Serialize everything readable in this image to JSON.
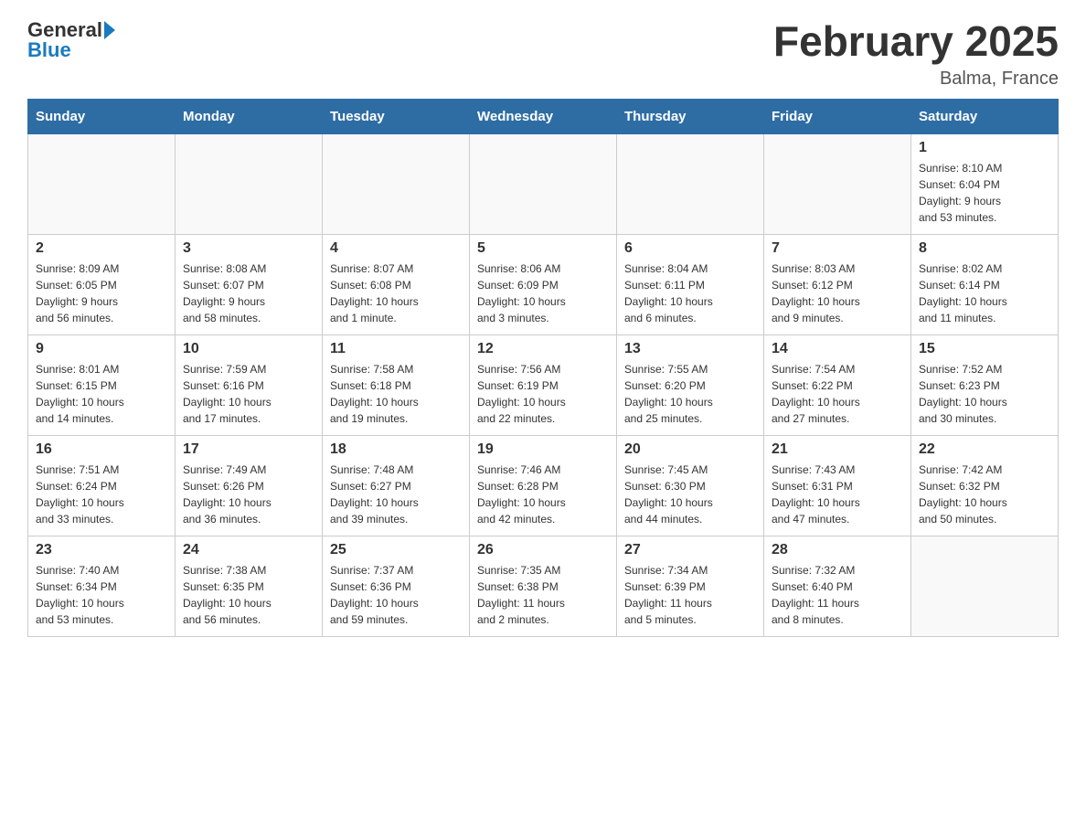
{
  "logo": {
    "general": "General",
    "blue": "Blue"
  },
  "title": "February 2025",
  "location": "Balma, France",
  "weekdays": [
    "Sunday",
    "Monday",
    "Tuesday",
    "Wednesday",
    "Thursday",
    "Friday",
    "Saturday"
  ],
  "weeks": [
    [
      {
        "day": "",
        "info": ""
      },
      {
        "day": "",
        "info": ""
      },
      {
        "day": "",
        "info": ""
      },
      {
        "day": "",
        "info": ""
      },
      {
        "day": "",
        "info": ""
      },
      {
        "day": "",
        "info": ""
      },
      {
        "day": "1",
        "info": "Sunrise: 8:10 AM\nSunset: 6:04 PM\nDaylight: 9 hours\nand 53 minutes."
      }
    ],
    [
      {
        "day": "2",
        "info": "Sunrise: 8:09 AM\nSunset: 6:05 PM\nDaylight: 9 hours\nand 56 minutes."
      },
      {
        "day": "3",
        "info": "Sunrise: 8:08 AM\nSunset: 6:07 PM\nDaylight: 9 hours\nand 58 minutes."
      },
      {
        "day": "4",
        "info": "Sunrise: 8:07 AM\nSunset: 6:08 PM\nDaylight: 10 hours\nand 1 minute."
      },
      {
        "day": "5",
        "info": "Sunrise: 8:06 AM\nSunset: 6:09 PM\nDaylight: 10 hours\nand 3 minutes."
      },
      {
        "day": "6",
        "info": "Sunrise: 8:04 AM\nSunset: 6:11 PM\nDaylight: 10 hours\nand 6 minutes."
      },
      {
        "day": "7",
        "info": "Sunrise: 8:03 AM\nSunset: 6:12 PM\nDaylight: 10 hours\nand 9 minutes."
      },
      {
        "day": "8",
        "info": "Sunrise: 8:02 AM\nSunset: 6:14 PM\nDaylight: 10 hours\nand 11 minutes."
      }
    ],
    [
      {
        "day": "9",
        "info": "Sunrise: 8:01 AM\nSunset: 6:15 PM\nDaylight: 10 hours\nand 14 minutes."
      },
      {
        "day": "10",
        "info": "Sunrise: 7:59 AM\nSunset: 6:16 PM\nDaylight: 10 hours\nand 17 minutes."
      },
      {
        "day": "11",
        "info": "Sunrise: 7:58 AM\nSunset: 6:18 PM\nDaylight: 10 hours\nand 19 minutes."
      },
      {
        "day": "12",
        "info": "Sunrise: 7:56 AM\nSunset: 6:19 PM\nDaylight: 10 hours\nand 22 minutes."
      },
      {
        "day": "13",
        "info": "Sunrise: 7:55 AM\nSunset: 6:20 PM\nDaylight: 10 hours\nand 25 minutes."
      },
      {
        "day": "14",
        "info": "Sunrise: 7:54 AM\nSunset: 6:22 PM\nDaylight: 10 hours\nand 27 minutes."
      },
      {
        "day": "15",
        "info": "Sunrise: 7:52 AM\nSunset: 6:23 PM\nDaylight: 10 hours\nand 30 minutes."
      }
    ],
    [
      {
        "day": "16",
        "info": "Sunrise: 7:51 AM\nSunset: 6:24 PM\nDaylight: 10 hours\nand 33 minutes."
      },
      {
        "day": "17",
        "info": "Sunrise: 7:49 AM\nSunset: 6:26 PM\nDaylight: 10 hours\nand 36 minutes."
      },
      {
        "day": "18",
        "info": "Sunrise: 7:48 AM\nSunset: 6:27 PM\nDaylight: 10 hours\nand 39 minutes."
      },
      {
        "day": "19",
        "info": "Sunrise: 7:46 AM\nSunset: 6:28 PM\nDaylight: 10 hours\nand 42 minutes."
      },
      {
        "day": "20",
        "info": "Sunrise: 7:45 AM\nSunset: 6:30 PM\nDaylight: 10 hours\nand 44 minutes."
      },
      {
        "day": "21",
        "info": "Sunrise: 7:43 AM\nSunset: 6:31 PM\nDaylight: 10 hours\nand 47 minutes."
      },
      {
        "day": "22",
        "info": "Sunrise: 7:42 AM\nSunset: 6:32 PM\nDaylight: 10 hours\nand 50 minutes."
      }
    ],
    [
      {
        "day": "23",
        "info": "Sunrise: 7:40 AM\nSunset: 6:34 PM\nDaylight: 10 hours\nand 53 minutes."
      },
      {
        "day": "24",
        "info": "Sunrise: 7:38 AM\nSunset: 6:35 PM\nDaylight: 10 hours\nand 56 minutes."
      },
      {
        "day": "25",
        "info": "Sunrise: 7:37 AM\nSunset: 6:36 PM\nDaylight: 10 hours\nand 59 minutes."
      },
      {
        "day": "26",
        "info": "Sunrise: 7:35 AM\nSunset: 6:38 PM\nDaylight: 11 hours\nand 2 minutes."
      },
      {
        "day": "27",
        "info": "Sunrise: 7:34 AM\nSunset: 6:39 PM\nDaylight: 11 hours\nand 5 minutes."
      },
      {
        "day": "28",
        "info": "Sunrise: 7:32 AM\nSunset: 6:40 PM\nDaylight: 11 hours\nand 8 minutes."
      },
      {
        "day": "",
        "info": ""
      }
    ]
  ]
}
